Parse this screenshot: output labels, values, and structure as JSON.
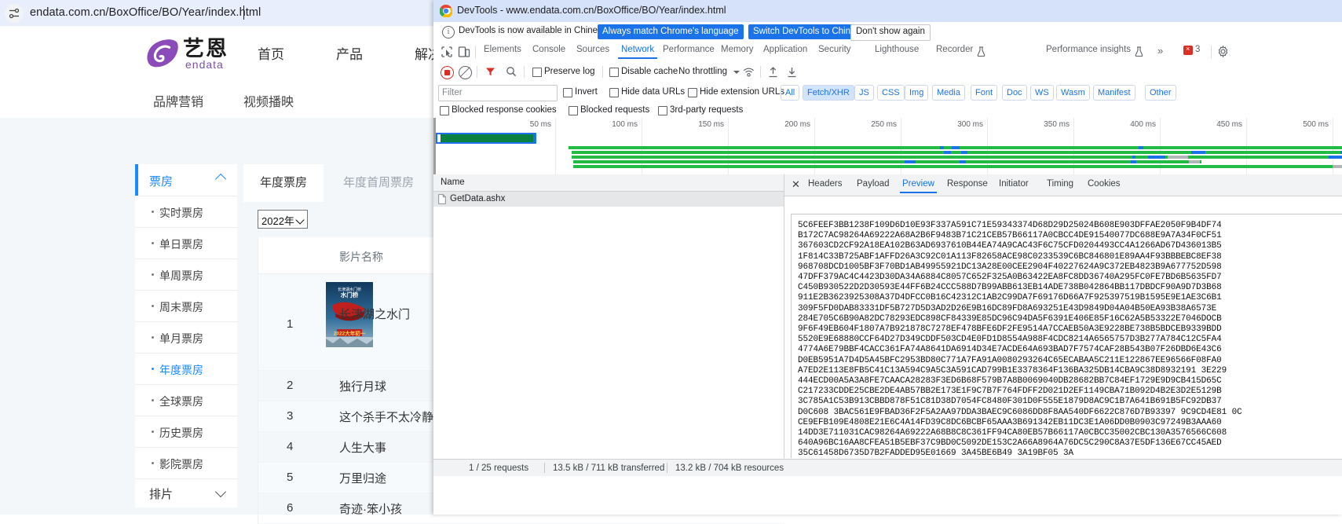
{
  "browser": {
    "omnibox": {
      "url": "endata.com.cn/BoxOffice/BO/Year/index.html",
      "site_settings_icon": "site-settings-icon"
    }
  },
  "site": {
    "logo": {
      "cn": "艺恩",
      "latin": "endata"
    },
    "top_nav": [
      "首页",
      "产品",
      "解决方"
    ],
    "sub_nav": [
      "品牌营销",
      "视频播映"
    ],
    "side_menu": {
      "header": "票房",
      "items": [
        "实时票房",
        "单日票房",
        "单周票房",
        "周末票房",
        "单月票房",
        "年度票房",
        "全球票房",
        "历史票房",
        "影院票房"
      ],
      "active_item": "年度票房",
      "footer": "排片"
    },
    "content": {
      "tabs": [
        {
          "label": "年度票房",
          "selected": true
        },
        {
          "label": "年度首周票房",
          "selected": false
        }
      ],
      "year_select": {
        "value": "2022年"
      },
      "table": {
        "columns": [
          "",
          "影片名称"
        ],
        "rows": [
          {
            "index": "1",
            "name": "长津湖之水门"
          },
          {
            "index": "2",
            "name": "独行月球"
          },
          {
            "index": "3",
            "name": "这个杀手不太冷静"
          },
          {
            "index": "4",
            "name": "人生大事"
          },
          {
            "index": "5",
            "name": "万里归途"
          },
          {
            "index": "6",
            "name": "奇迹·笨小孩"
          }
        ]
      }
    }
  },
  "devtools": {
    "window": {
      "title": "DevTools - www.endata.com.cn/BoxOffice/BO/Year/index.html",
      "minimize": "—",
      "maximize": "□",
      "close": "✕"
    },
    "infobar": {
      "message": "DevTools is now available in Chinese!",
      "buttons": [
        {
          "label": "Always match Chrome's language",
          "style": "blue"
        },
        {
          "label": "Switch DevTools to Chinese",
          "style": "blue"
        },
        {
          "label": "Don't show again",
          "style": "plain"
        }
      ]
    },
    "tabs": [
      {
        "label": "Elements",
        "selected": false
      },
      {
        "label": "Console",
        "selected": false
      },
      {
        "label": "Sources",
        "selected": false
      },
      {
        "label": "Network",
        "selected": true
      },
      {
        "label": "Performance",
        "selected": false
      },
      {
        "label": "Memory",
        "selected": false
      },
      {
        "label": "Application",
        "selected": false
      },
      {
        "label": "Security",
        "selected": false
      },
      {
        "label": "Lighthouse",
        "selected": false
      },
      {
        "label": "Recorder",
        "selected": false
      },
      {
        "label": "Performance insights",
        "selected": false
      }
    ],
    "tabs_overflow": "»",
    "error_count": "3",
    "network_toolbar": {
      "preserve_log": "Preserve log",
      "disable_cache": "Disable cache",
      "throttling": "No throttling"
    },
    "filter_row": {
      "filter_placeholder": "Filter",
      "invert": "Invert",
      "hide_data_urls": "Hide data URLs",
      "hide_extension_urls": "Hide extension URLs",
      "types": [
        {
          "label": "All",
          "active": false
        },
        {
          "label": "Fetch/XHR",
          "active": true
        },
        {
          "label": "JS",
          "active": false
        },
        {
          "label": "CSS",
          "active": false
        },
        {
          "label": "Img",
          "active": false
        },
        {
          "label": "Media",
          "active": false
        },
        {
          "label": "Font",
          "active": false
        },
        {
          "label": "Doc",
          "active": false
        },
        {
          "label": "WS",
          "active": false
        },
        {
          "label": "Wasm",
          "active": false
        },
        {
          "label": "Manifest",
          "active": false
        },
        {
          "label": "Other",
          "active": false
        }
      ]
    },
    "blocked_row": {
      "blocked_response_cookies": "Blocked response cookies",
      "blocked_requests": "Blocked requests",
      "third_party_requests": "3rd-party requests"
    },
    "overview": {
      "ticks": [
        "50 ms",
        "100 ms",
        "150 ms",
        "200 ms",
        "250 ms",
        "300 ms",
        "350 ms",
        "400 ms",
        "450 ms",
        "500 ms"
      ]
    },
    "request_list": {
      "column_header": "Name",
      "rows": [
        {
          "name": "GetData.ashx",
          "selected": true
        }
      ]
    },
    "detail_tabs": [
      {
        "label": "Headers",
        "selected": false
      },
      {
        "label": "Payload",
        "selected": false
      },
      {
        "label": "Preview",
        "selected": true
      },
      {
        "label": "Response",
        "selected": false
      },
      {
        "label": "Initiator",
        "selected": false
      },
      {
        "label": "Timing",
        "selected": false
      },
      {
        "label": "Cookies",
        "selected": false
      }
    ],
    "preview_text": "5C6FEEF3BB1238F109D6D10E93F337A591C71E59343374D68D29D25024B608E903DFFAE2050F9B4DF74\nB172C7AC98264A69222A68A2B6F9483B71C21CEB57B66117A0CBCC4DE91540077DC688E9A7A34F0CF51\n367603CD2CF92A18EA102B63AD6937610B44EA74A9CAC43F6C75CFD0204493CC4A1266AD67D436013B5\n1F814C33B725ABF1AFFD26A3C92C01A113F82658ACE98C0233539C6BC846801E89AA4F93BBBEBC8EF38\n968708DCD1005BF3F70BD1AB49955921DC13A28E00CEE2904F40227624A9C372EB4823B9A677752D598\n47DFF379AC4C4423D30DA34A6884C8057C652F325A0B63422EA8FC8DD36740A295FC0FE7BD6B5635FD7\nC450B930522D2D30593E44FF6B24CCC588D7B99ABB613EB14ADE738B042864BB117DBDCF90A9D7D3B68\n911E2B3623925308A37D4DFCC0B16C42312C1AB2C99DA7F69176D66A7F925397519B1595E9E1AE3C6B1\n309F5FD0DAB83331DF5B727D5D3AD2D26E9B16DC89FD8A693251E43D9849D04A04B50EA93B38A6573E\n284E705C6B90A82DC78293EDC898CF84339E85DC96C94DA5F6391E406E85F16C62A5B53322E7046DOCB\n9F6F49EB604F1807A7B921878C7278EF478BFE6DF2FE9514A7CCAEB50A3E9228BE738B5BDCEB9339BDD\n5520E9E68880CCF64D27D349CDDF503CD4E0FD1D8554A988F4CDC8214A6565757D3B277A784C12C5FA4\n4774A6E79BBF4CACC361FA74A8641DA6914D34E7ACDE64A693BAD7F7574CAF28B543B07F26DBD6E43C6\nD0EB5951A7D4D5A45BFC2953BD80C771A7FA91A0080293264C65ECABAA5C211E122867EE96566F08FA0\nA7ED2E113E8FB5C41C13A594C9A5C3A591CAD799B1E3378364F136BA325DB14CBA9C38D8932191 3E229\n444ECD00A5A3A8FE7CAACA28283F3ED6B68F579B7A8B0069040DB28682BB7C84EF1729E9D9CB415D65C\nC217233CDDE25CBE2DE4AB57BB2E173E1F9C7B7F764FDFF2D021D2EF1149CBA71B092D4B2E3D2E5129B\n3C785A1C53B913CBBD878F51C81D38D7054FC8480F301D0F555E1879D8AC9C1B7A641B691B5FC92DB37\nD0C608 3BAC561E9FBAD36F2F5A2AA97DDA3BAEC9C6086DD8F8AA540DF6622C876D7B93397 9C9CD4E81 0C\nCE9EFB109E4808E21E6C4A14FD39C8DC6BCBF65AAA3B691342EB11DC3E1A06DD0B0903C97249B3AAA60\n14DD3E711031CAC98264A69222A68B8C8C361FF94CA80EB57B66117A0CBCC35002CBC130A3576566C608\n640A96BC16AA8CFEA51B5EBF37C9BD0C5092DE153C2A66A8964A76DC5C290C8A37E5DF136E67CC45AED\n35C61458D6735D7B2FADDED95E01669 3A45BE6B49 3A19BF05 3A",
    "status_bar": {
      "requests": "1 / 25 requests",
      "transferred": "13.5 kB / 711 kB transferred",
      "resources": "13.2 kB / 704 kB resources"
    }
  }
}
